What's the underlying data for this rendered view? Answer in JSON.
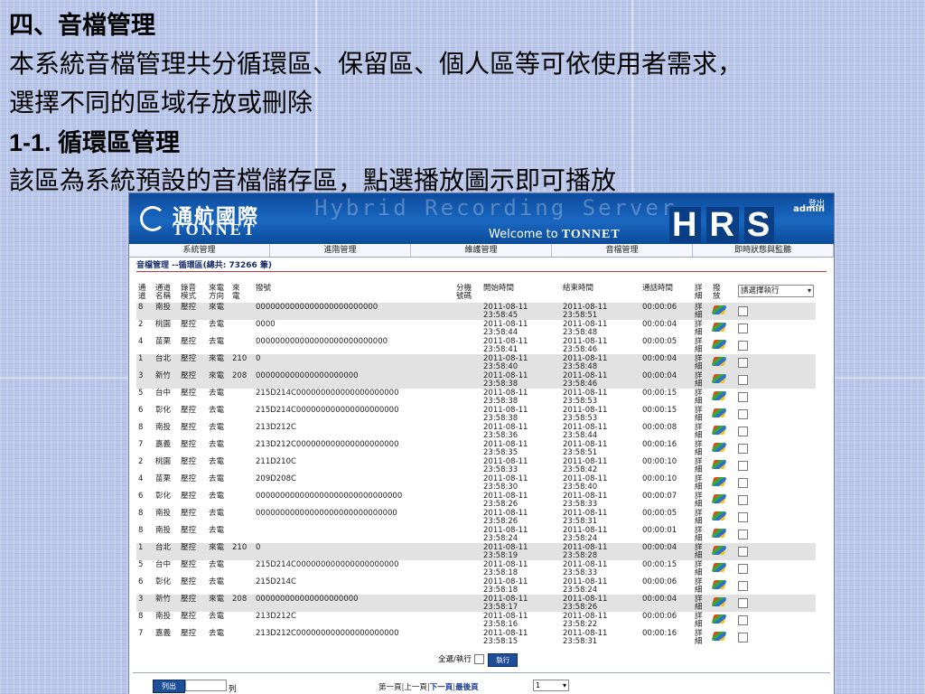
{
  "slide": {
    "heading": "四、音檔管理",
    "line1": "本系統音檔管理共分循環區、保留區、個人區等可依使用者需求，",
    "line2": "選擇不同的區域存放或刪除",
    "subheading": "1-1. 循環區管理",
    "line3": "該區為系統預設的音檔儲存區，點選播放圖示即可播放"
  },
  "app": {
    "logo_cn": "通航國際",
    "logo_en": "TONNET",
    "hybrid": "Hybrid Recording Server",
    "welcome": "Welcome to",
    "welcome_brand": "TONNET",
    "hrs": [
      "H",
      "R",
      "S"
    ],
    "logout": "登出",
    "user": "admin",
    "menu": [
      "系統管理",
      "進階管理",
      "維護管理",
      "音檔管理",
      "即時狀態與監聽"
    ],
    "crumb": "音檔管理 --循環區(總共: 73266 筆)",
    "columns": {
      "ch": "通\n道",
      "name": "通道\n名稱",
      "mode": "錄音\n模式",
      "dir": "來電\n方向",
      "in": "來\n電",
      "dial": "撥號",
      "ext": "分機\n號碼",
      "start": "開始時間",
      "end": "結束時間",
      "dur": "通話時間",
      "det": "詳\n細",
      "play": "撥\n放"
    },
    "action_select": "請選擇執行",
    "detail_text": "詳\n細",
    "rows": [
      {
        "ch": "8",
        "name": "南投",
        "mode": "壓控",
        "dir": "來電",
        "in": "",
        "dial": "0000000000000000000000000",
        "ext": "",
        "start_d": "2011-08-11",
        "start_t": "23:58:45",
        "end_d": "2011-08-11",
        "end_t": "23:58:51",
        "dur": "00:00:06",
        "gray": true
      },
      {
        "ch": "2",
        "name": "桃園",
        "mode": "壓控",
        "dir": "去電",
        "in": "",
        "dial": "0000",
        "ext": "",
        "start_d": "2011-08-11",
        "start_t": "23:58:44",
        "end_d": "2011-08-11",
        "end_t": "23:58:48",
        "dur": "00:00:04",
        "gray": false
      },
      {
        "ch": "4",
        "name": "苗栗",
        "mode": "壓控",
        "dir": "去電",
        "in": "",
        "dial": "000000000000000000000000000",
        "ext": "",
        "start_d": "2011-08-11",
        "start_t": "23:58:41",
        "end_d": "2011-08-11",
        "end_t": "23:58:46",
        "dur": "00:00:05",
        "gray": false
      },
      {
        "ch": "1",
        "name": "台北",
        "mode": "壓控",
        "dir": "來電",
        "in": "210",
        "dial": "0",
        "ext": "",
        "start_d": "2011-08-11",
        "start_t": "23:58:40",
        "end_d": "2011-08-11",
        "end_t": "23:58:48",
        "dur": "00:00:04",
        "gray": true
      },
      {
        "ch": "3",
        "name": "新竹",
        "mode": "壓控",
        "dir": "來電",
        "in": "208",
        "dial": "000000000000000000000",
        "ext": "",
        "start_d": "2011-08-11",
        "start_t": "23:58:38",
        "end_d": "2011-08-11",
        "end_t": "23:58:46",
        "dur": "00:00:04",
        "gray": true
      },
      {
        "ch": "5",
        "name": "台中",
        "mode": "壓控",
        "dir": "去電",
        "in": "",
        "dial": "215D214C000000000000000000000",
        "ext": "",
        "start_d": "2011-08-11",
        "start_t": "23:58:38",
        "end_d": "2011-08-11",
        "end_t": "23:58:53",
        "dur": "00:00:15",
        "gray": false
      },
      {
        "ch": "6",
        "name": "彰化",
        "mode": "壓控",
        "dir": "去電",
        "in": "",
        "dial": "215D214C000000000000000000000",
        "ext": "",
        "start_d": "2011-08-11",
        "start_t": "23:58:38",
        "end_d": "2011-08-11",
        "end_t": "23:58:53",
        "dur": "00:00:15",
        "gray": false
      },
      {
        "ch": "8",
        "name": "南投",
        "mode": "壓控",
        "dir": "去電",
        "in": "",
        "dial": "213D212C",
        "ext": "",
        "start_d": "2011-08-11",
        "start_t": "23:58:36",
        "end_d": "2011-08-11",
        "end_t": "23:58:44",
        "dur": "00:00:08",
        "gray": false
      },
      {
        "ch": "7",
        "name": "嘉義",
        "mode": "壓控",
        "dir": "去電",
        "in": "",
        "dial": "213D212C000000000000000000000",
        "ext": "",
        "start_d": "2011-08-11",
        "start_t": "23:58:35",
        "end_d": "2011-08-11",
        "end_t": "23:58:51",
        "dur": "00:00:16",
        "gray": false
      },
      {
        "ch": "2",
        "name": "桃園",
        "mode": "壓控",
        "dir": "去電",
        "in": "",
        "dial": "211D210C",
        "ext": "",
        "start_d": "2011-08-11",
        "start_t": "23:58:33",
        "end_d": "2011-08-11",
        "end_t": "23:58:42",
        "dur": "00:00:10",
        "gray": false
      },
      {
        "ch": "4",
        "name": "苗栗",
        "mode": "壓控",
        "dir": "去電",
        "in": "",
        "dial": "209D208C",
        "ext": "",
        "start_d": "2011-08-11",
        "start_t": "23:58:30",
        "end_d": "2011-08-11",
        "end_t": "23:58:40",
        "dur": "00:00:10",
        "gray": false
      },
      {
        "ch": "6",
        "name": "彰化",
        "mode": "壓控",
        "dir": "去電",
        "in": "",
        "dial": "000000000000000000000000000000",
        "ext": "",
        "start_d": "2011-08-11",
        "start_t": "23:58:26",
        "end_d": "2011-08-11",
        "end_t": "23:58:33",
        "dur": "00:00:07",
        "gray": false
      },
      {
        "ch": "8",
        "name": "南投",
        "mode": "壓控",
        "dir": "去電",
        "in": "",
        "dial": "00000000000000000000000000000",
        "ext": "",
        "start_d": "2011-08-11",
        "start_t": "23:58:26",
        "end_d": "2011-08-11",
        "end_t": "23:58:31",
        "dur": "00:00:05",
        "gray": false
      },
      {
        "ch": "8",
        "name": "南投",
        "mode": "壓控",
        "dir": "去電",
        "in": "",
        "dial": "",
        "ext": "",
        "start_d": "2011-08-11",
        "start_t": "23:58:24",
        "end_d": "2011-08-11",
        "end_t": "23:58:24",
        "dur": "00:00:01",
        "gray": false
      },
      {
        "ch": "1",
        "name": "台北",
        "mode": "壓控",
        "dir": "來電",
        "in": "210",
        "dial": "0",
        "ext": "",
        "start_d": "2011-08-11",
        "start_t": "23:58:19",
        "end_d": "2011-08-11",
        "end_t": "23:58:28",
        "dur": "00:00:04",
        "gray": true
      },
      {
        "ch": "5",
        "name": "台中",
        "mode": "壓控",
        "dir": "去電",
        "in": "",
        "dial": "215D214C000000000000000000000",
        "ext": "",
        "start_d": "2011-08-11",
        "start_t": "23:58:18",
        "end_d": "2011-08-11",
        "end_t": "23:58:33",
        "dur": "00:00:15",
        "gray": false
      },
      {
        "ch": "6",
        "name": "彰化",
        "mode": "壓控",
        "dir": "去電",
        "in": "",
        "dial": "215D214C",
        "ext": "",
        "start_d": "2011-08-11",
        "start_t": "23:58:18",
        "end_d": "2011-08-11",
        "end_t": "23:58:24",
        "dur": "00:00:06",
        "gray": false
      },
      {
        "ch": "3",
        "name": "新竹",
        "mode": "壓控",
        "dir": "來電",
        "in": "208",
        "dial": "000000000000000000000",
        "ext": "",
        "start_d": "2011-08-11",
        "start_t": "23:58:17",
        "end_d": "2011-08-11",
        "end_t": "23:58:26",
        "dur": "00:00:04",
        "gray": true
      },
      {
        "ch": "8",
        "name": "南投",
        "mode": "壓控",
        "dir": "去電",
        "in": "",
        "dial": "213D212C",
        "ext": "",
        "start_d": "2011-08-11",
        "start_t": "23:58:16",
        "end_d": "2011-08-11",
        "end_t": "23:58:22",
        "dur": "00:00:06",
        "gray": false
      },
      {
        "ch": "7",
        "name": "嘉義",
        "mode": "壓控",
        "dir": "去電",
        "in": "",
        "dial": "213D212C000000000000000000000",
        "ext": "",
        "start_d": "2011-08-11",
        "start_t": "23:58:15",
        "end_d": "2011-08-11",
        "end_t": "23:58:31",
        "dur": "00:00:16",
        "gray": false
      }
    ],
    "select_all_label": "全選/執行",
    "exec_button": "執行",
    "perpage_button": "列出",
    "perpage_unit": "列",
    "pager": {
      "first": "第一頁",
      "prev": "上一頁",
      "next": "下一頁",
      "last": "最後頁",
      "sep": "|"
    },
    "page_select": "1"
  }
}
